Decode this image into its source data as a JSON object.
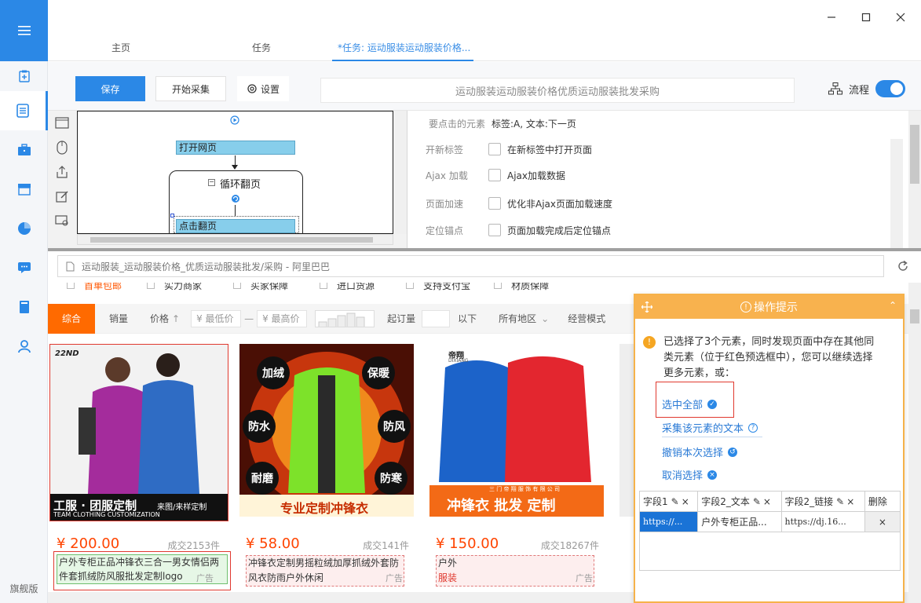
{
  "sidebar": {
    "footer": "旗舰版",
    "items": [
      "clipboard-plus-icon",
      "document-icon",
      "briefcase-icon",
      "store-icon",
      "pie-chart-icon",
      "chat-icon",
      "book-icon",
      "user-icon"
    ]
  },
  "tabs": [
    "主页",
    "任务",
    "*任务: 运动服装运动服装价格..."
  ],
  "toolbar": {
    "save": "保存",
    "start": "开始采集",
    "settings": "设置",
    "url_text": "运动服装运动服装价格优质运动服装批发采购",
    "flow": "流程"
  },
  "flow": {
    "open_page": "打开网页",
    "loop": "循环翻页",
    "click_page": "点击翻页"
  },
  "props": {
    "click_el_label": "要点击的元素",
    "click_el_value": "标签:A, 文本:下一页",
    "rows": [
      {
        "label": "开新标签",
        "value": "在新标签中打开页面"
      },
      {
        "label": "Ajax 加载",
        "value": "Ajax加载数据"
      },
      {
        "label": "页面加速",
        "value": "优化非Ajax页面加载速度"
      },
      {
        "label": "定位锚点",
        "value": "页面加载完成后定位锚点"
      }
    ]
  },
  "browser": {
    "address": "运动服装_运动服装价格_优质运动服装批发/采购 - 阿里巴巴",
    "check_row": [
      "首单包邮",
      "实力商家",
      "买家保障",
      "进口货源",
      "支持支付宝",
      "材质保障"
    ],
    "filters": {
      "comprehensive": "综合",
      "sales": "销量",
      "price": "价格",
      "min_price": "¥ 最低价",
      "dash": "—",
      "max_price": "¥ 最高价",
      "moq": "起订量",
      "below": "以下",
      "regions": "所有地区",
      "mode": "经营模式"
    },
    "products": [
      {
        "price": "¥ 200.00",
        "sold": "成交2153件",
        "title": "户外专柜正品冲锋衣三合一男女情侣两件套抓绒防风服批发定制logo",
        "ad": "广告",
        "banner": "工服 · 团服定制",
        "banner2": "来图/来样定制",
        "banner3": "TEAM CLOTHING CUSTOMIZATION",
        "brand": "22ND"
      },
      {
        "price": "¥ 58.00",
        "sold": "成交141件",
        "title": "冲锋衣定制男摇粒绒加厚抓绒外套防风衣防雨户外休闲",
        "ad": "广告",
        "banner": "专业定制冲锋衣",
        "tags": [
          "加绒",
          "保暖",
          "防水",
          "防风",
          "耐磨",
          "防寒"
        ]
      },
      {
        "price": "¥ 150.00",
        "sold": "成交18267件",
        "title": "户外",
        "title2": "服装",
        "ad": "广告",
        "banner": "冲锋衣 批发 定制",
        "small": "三 门 帝 翔 服 饰 有 限 公 司",
        "brand": "帝翔",
        "brand2": "DIXIANG"
      }
    ]
  },
  "tips": {
    "title": "操作提示",
    "message": "已选择了3个元素，同时发现页面中存在其他同类元素（位于红色预选框中），您可以继续选择更多元素，或：",
    "links": [
      "选中全部",
      "采集该元素的文本",
      "撤销本次选择",
      "取消选择"
    ],
    "table": {
      "headers": [
        "字段1",
        "字段2_文本",
        "字段2_链接",
        "删除"
      ],
      "row": [
        "https://...",
        "户外专柜正品...",
        "https://dj.16..."
      ]
    }
  },
  "colors": {
    "accent": "#2b88e6",
    "orange": "#ff6a00",
    "tips": "#f8b24e",
    "price": "#ff4400"
  }
}
